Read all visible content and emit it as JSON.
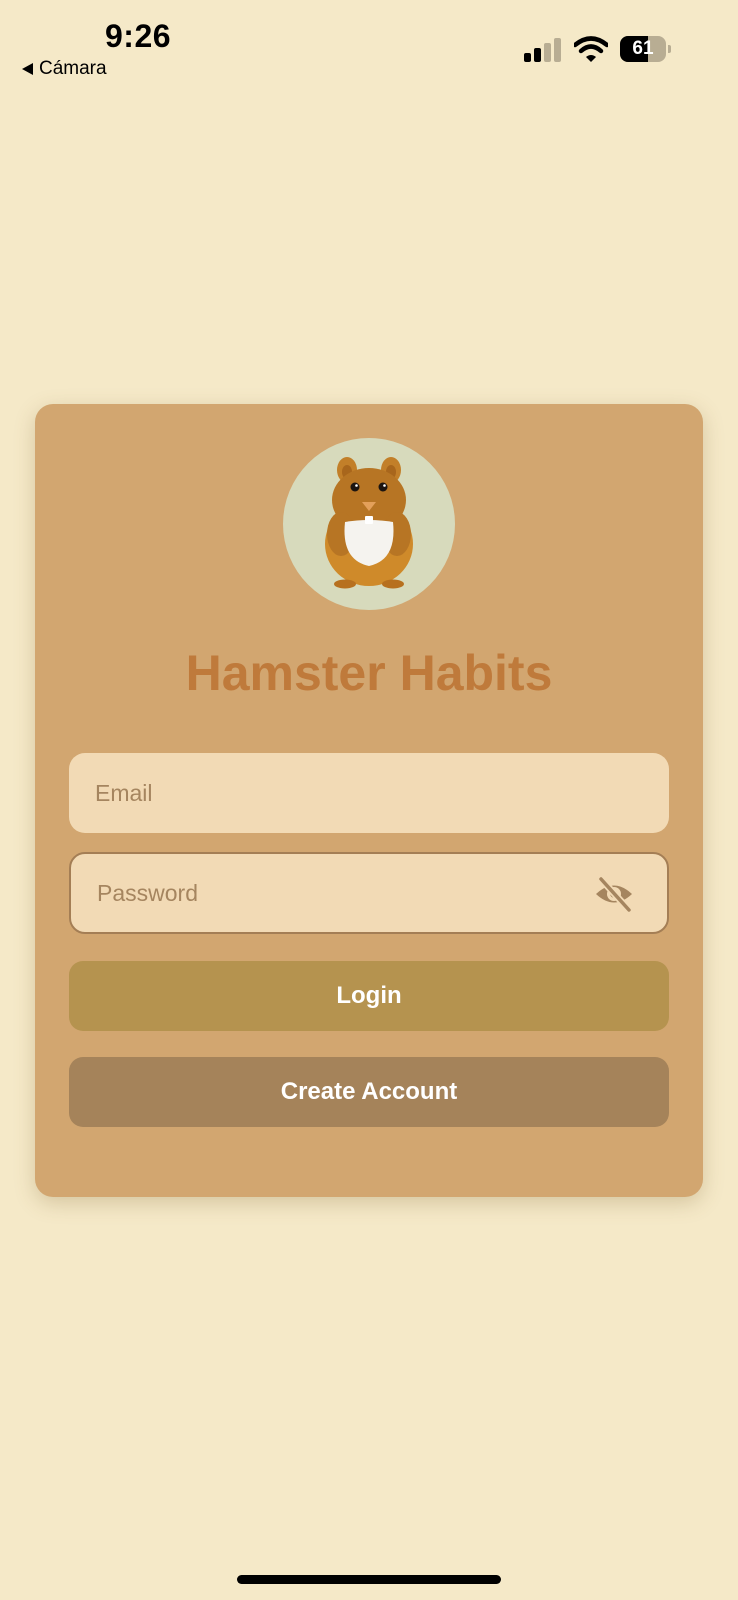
{
  "status_bar": {
    "time": "9:26",
    "back_label": "Cámara",
    "battery_level": "61",
    "battery_fraction": 0.61,
    "signal_bars_active": 2,
    "signal_bars_total": 4
  },
  "card": {
    "app_title": "Hamster Habits",
    "email": {
      "placeholder": "Email",
      "value": ""
    },
    "password": {
      "placeholder": "Password",
      "value": ""
    },
    "login_label": "Login",
    "create_account_label": "Create Account",
    "visibility_icon": "eye-slash-icon"
  },
  "colors": {
    "background": "#f5e9c8",
    "card": "#d2a670",
    "title": "#bf7a3b",
    "input": "#f2dab5",
    "login_button": "#b5934f",
    "create_button": "#a5835a"
  }
}
